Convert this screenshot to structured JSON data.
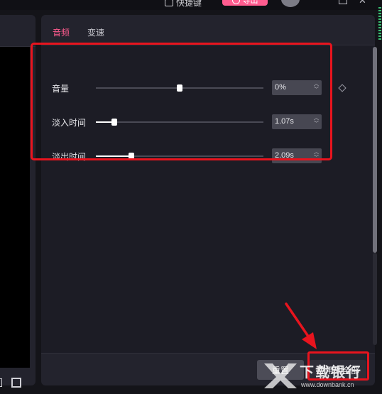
{
  "topbar": {
    "shortcut_label": "快捷键",
    "export_label": "导出"
  },
  "tabs": [
    {
      "label": "音频",
      "active": true
    },
    {
      "label": "变速",
      "active": false
    }
  ],
  "audio_rows": [
    {
      "label": "音量",
      "value": "0%",
      "position": 0.5
    },
    {
      "label": "淡入时间",
      "value": "1.07s",
      "position": 0.11
    },
    {
      "label": "淡出时间",
      "value": "2.09s",
      "position": 0.21
    }
  ],
  "footer": {
    "reset_label": "重置",
    "apply_label": "应用到全部"
  },
  "watermark": {
    "brand": "下载银行",
    "url": "www.downbank.cn"
  },
  "colors": {
    "accent": "#ff5c8f",
    "highlight": "#e8141e",
    "panel": "#23232d",
    "background": "#141419"
  }
}
